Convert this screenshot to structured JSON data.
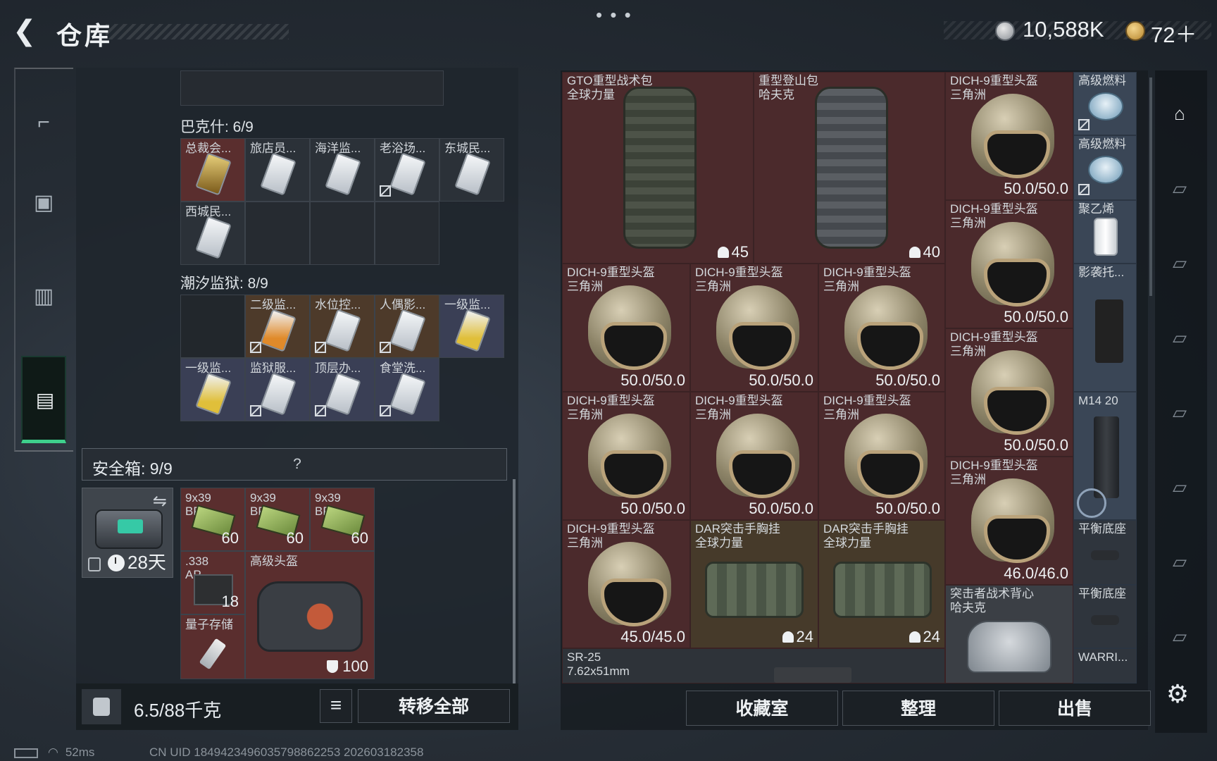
{
  "header": {
    "back_icon": "back-arrow-icon",
    "title": "仓库",
    "more_icon": "more-dots-icon",
    "money": "10,588K",
    "gold": "72＋"
  },
  "left_nav": {
    "items": [
      "gun-icon",
      "backpack-icon",
      "vest-icon",
      "toolbox-icon"
    ],
    "active": "toolbox-icon"
  },
  "storage": {
    "section1_title": "巴克什: 6/9",
    "section1_items": [
      "总裁会...",
      "旅店员...",
      "海洋监...",
      "老浴场...",
      "东城民...",
      "西城民..."
    ],
    "section2_title": "潮汐监狱: 8/9",
    "section2_items": [
      "二级监...",
      "水位控...",
      "人偶影...",
      "一级监...",
      "一级监...",
      "监狱服...",
      "顶层办...",
      "食堂洗..."
    ],
    "safe_title": "安全箱:  9/9",
    "safe_help": "?",
    "safe_days": "28天",
    "ammo": [
      {
        "label": "9x39\nBP",
        "count": "60"
      },
      {
        "label": "9x39\nBP",
        "count": "60"
      },
      {
        "label": "9x39\nBP",
        "count": "60"
      }
    ],
    "ap_label": ".338\nAP",
    "ap_count": "18",
    "quantum_label": "量子存储",
    "bag_label": "高级头盔",
    "bag_count": "100"
  },
  "bottom_bar": {
    "weight": "6.5/88千克",
    "list_icon": "≡",
    "transfer_label": "转移全部"
  },
  "status": {
    "ping": "52ms",
    "uid": "CN UID 1849423496035798862253  202603182358"
  },
  "right_grid": {
    "backpacks": [
      {
        "name": "GTO重型战术包\n全球力量",
        "count": "45"
      },
      {
        "name": "重型登山包\n哈夫克",
        "count": "40"
      }
    ],
    "helmet_name": "DICH-9重型头盔\n三角洲",
    "helmet_dur": "50.0/50.0",
    "helmet_dur_46": "46.0/46.0",
    "helmet_dur_45": "45.0/45.0",
    "rig_name": "DAR突击手胸挂\n全球力量",
    "rig_count": "24",
    "vest_name": "突击者战术背心\n哈夫克",
    "sr25_name": "SR-25\n7.62x51mm",
    "col5": [
      "高级燃料",
      "高级燃料",
      "聚乙烯",
      "影袭托...",
      "M14 20",
      "平衡底座",
      "平衡底座",
      "WARRI..."
    ]
  },
  "right_buttons": {
    "collection": "收藏室",
    "sort": "整理",
    "sell": "出售"
  },
  "right_nav": {
    "items": [
      "home-icon",
      "tier4-icon",
      "tier4-icon",
      "tier4-icon",
      "tier4-icon",
      "tier4-icon",
      "tier4-icon",
      "tier4-icon"
    ],
    "settings_icon": "gear-icon"
  }
}
